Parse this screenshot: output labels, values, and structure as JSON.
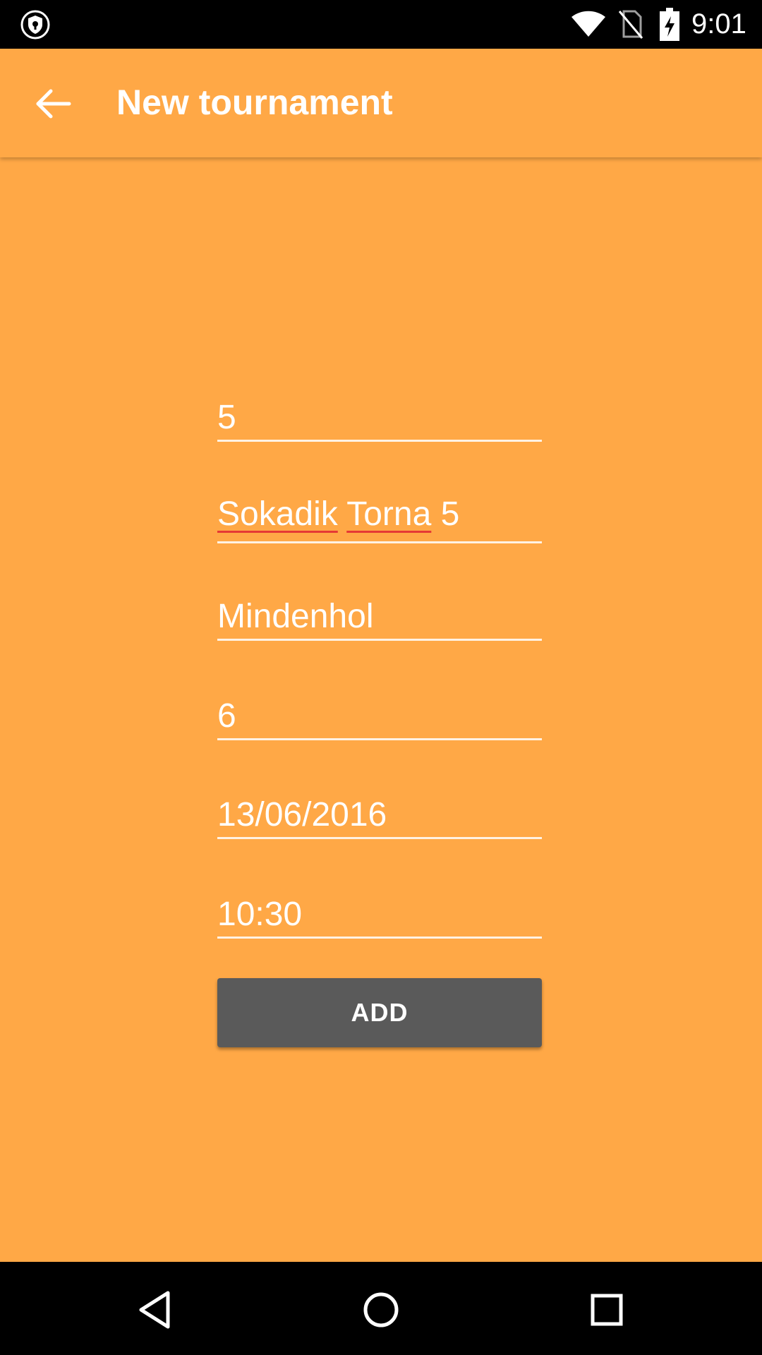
{
  "status_bar": {
    "time": "9:01",
    "icons": [
      "shield-icon",
      "wifi-icon",
      "no-sim-icon",
      "battery-charging-icon"
    ]
  },
  "app_bar": {
    "title": "New tournament",
    "back_icon": "arrow-back-icon"
  },
  "form": {
    "fields": [
      {
        "name": "id",
        "value": "5"
      },
      {
        "name": "tournament_name",
        "words": [
          "Sokadik",
          "Torna",
          "5"
        ],
        "value": "Sokadik Torna 5",
        "misspelled": [
          "Sokadik",
          "Torna"
        ]
      },
      {
        "name": "location",
        "value": "Mindenhol"
      },
      {
        "name": "number",
        "value": "6"
      },
      {
        "name": "date",
        "value": "13/06/2016"
      },
      {
        "name": "time",
        "value": "10:30"
      }
    ],
    "add_label": "ADD"
  },
  "nav_bar": {
    "icons": [
      "back-triangle-icon",
      "home-circle-icon",
      "recents-square-icon"
    ]
  },
  "colors": {
    "background": "#FFA846",
    "button": "#5A5A5A",
    "spellcheck_underline": "#e53935"
  }
}
